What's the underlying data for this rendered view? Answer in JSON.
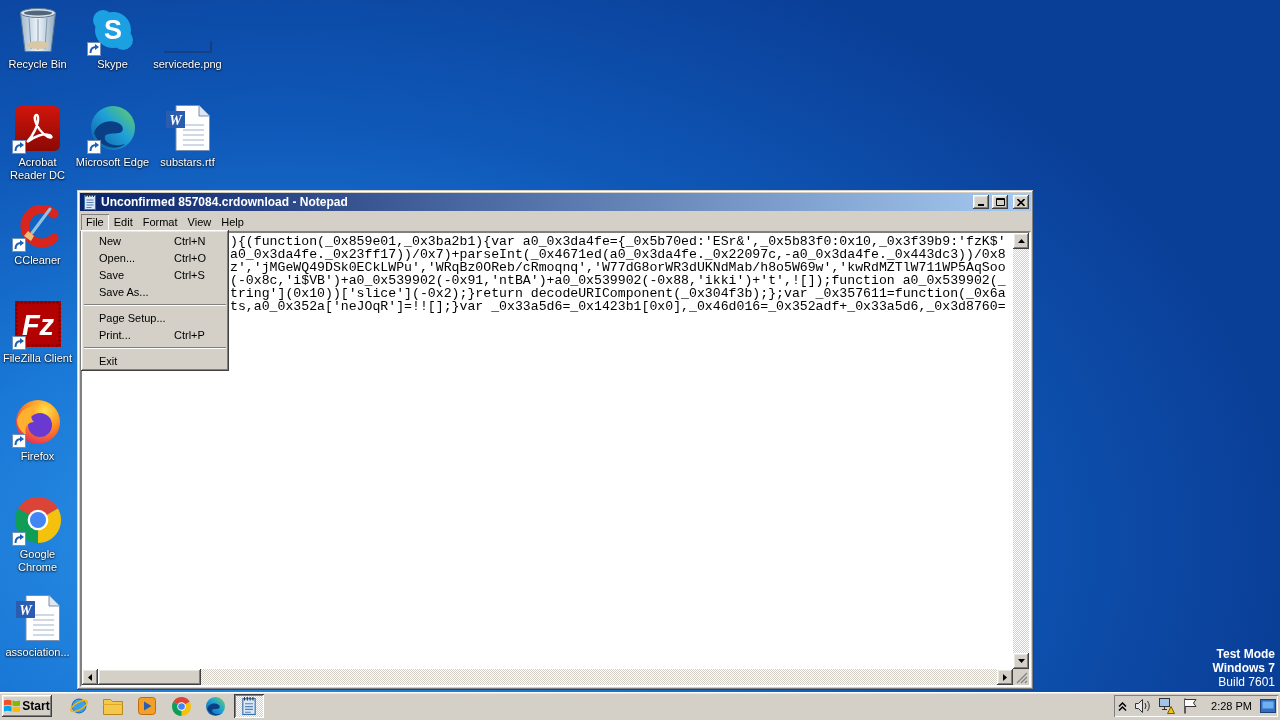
{
  "desktop": {
    "icon_columns": [
      {
        "icons": [
          {
            "label": "Recycle Bin",
            "kind": "recycle-bin",
            "shortcut": false
          },
          {
            "label": "Acrobat Reader DC",
            "kind": "acrobat",
            "shortcut": true
          },
          {
            "label": "CCleaner",
            "kind": "ccleaner",
            "shortcut": true
          },
          {
            "label": "FileZilla Client",
            "kind": "filezilla",
            "shortcut": true,
            "glyph": "Fz"
          },
          {
            "label": "Firefox",
            "kind": "firefox",
            "shortcut": true
          },
          {
            "label": "Google Chrome",
            "kind": "chrome",
            "shortcut": true
          },
          {
            "label": "association...",
            "kind": "document",
            "shortcut": false,
            "glyph": "W"
          }
        ]
      },
      {
        "icons": [
          {
            "label": "Skype",
            "kind": "skype",
            "shortcut": true,
            "glyph": "S"
          },
          {
            "label": "Microsoft Edge",
            "kind": "edge",
            "shortcut": true
          }
        ]
      },
      {
        "icons": [
          {
            "label": "servicede.png",
            "kind": "image",
            "shortcut": false
          },
          {
            "label": "substars.rtf",
            "kind": "document",
            "shortcut": false,
            "glyph": "W"
          }
        ]
      }
    ],
    "notice": [
      {
        "text": "Test Mode",
        "bold": true
      },
      {
        "text": "Windows 7",
        "bold": true
      },
      {
        "text": "Build 7601",
        "bold": false
      }
    ]
  },
  "notepad": {
    "title": "Unconfirmed 857084.crdownload - Notepad",
    "menu": [
      {
        "label": "File",
        "selected": true,
        "items": [
          {
            "kind": "command",
            "label": "New",
            "shortcut": "Ctrl+N"
          },
          {
            "kind": "command",
            "label": "Open...",
            "shortcut": "Ctrl+O"
          },
          {
            "kind": "command",
            "label": "Save",
            "shortcut": "Ctrl+S"
          },
          {
            "kind": "command",
            "label": "Save As..."
          },
          {
            "kind": "separator"
          },
          {
            "kind": "command",
            "label": "Page Setup..."
          },
          {
            "kind": "command",
            "label": "Print...",
            "shortcut": "Ctrl+P"
          },
          {
            "kind": "separator"
          },
          {
            "kind": "command",
            "label": "Exit"
          }
        ]
      },
      {
        "label": "Edit",
        "selected": false
      },
      {
        "label": "Format",
        "selected": false
      },
      {
        "label": "View",
        "selected": false
      },
      {
        "label": "Help",
        "selected": false
      }
    ],
    "lines": [
      "){(function(_0x859e01,_0x3ba2b1){var a0_0x3da4fe={_0x5b70ed:'ESr&',_0x5b83f0:0x10,_0x3f39b9:'fzK$'",
      "a0_0x3da4fe._0x23ff17))/0x7)+parseInt(_0x4671ed(a0_0x3da4fe._0x22097c,-a0_0x3da4fe._0x443dc3))/0x8",
      "z','jMGeWQ49DSk0ECkLWPu','WRqBz0OReb/cRmoqnq','W77dG8orWR3dUKNdMab/h8o5W69w','kwRdMZTlW711WP5AqSoo",
      "(-0x8c,'i$VB')+a0_0x539902(-0x91,'ntBA')+a0_0x539902(-0x88,'ikki')+'t',![]);function a0_0x539902(_",
      "tring'](0x10))['slice'](-0x2);}return decodeURIComponent(_0x304f3b);};var _0x357611=function(_0x6a",
      "ts,a0_0x352a['neJOqR']=!![];}var _0x33a5d6=_0x1423b1[0x0],_0x46d016=_0x352adf+_0x33a5d6,_0x3d8760="
    ]
  },
  "taskbar": {
    "start": "Start",
    "pinned": [
      {
        "kind": "ie",
        "active": false
      },
      {
        "kind": "folder",
        "active": false
      },
      {
        "kind": "media-player",
        "active": false
      },
      {
        "kind": "chrome",
        "active": false
      },
      {
        "kind": "edge",
        "active": false
      },
      {
        "kind": "notepad",
        "active": true
      }
    ],
    "tray": [
      {
        "kind": "chevron"
      },
      {
        "kind": "speaker"
      },
      {
        "kind": "network"
      },
      {
        "kind": "flag"
      }
    ],
    "clock": "2:28 PM"
  }
}
